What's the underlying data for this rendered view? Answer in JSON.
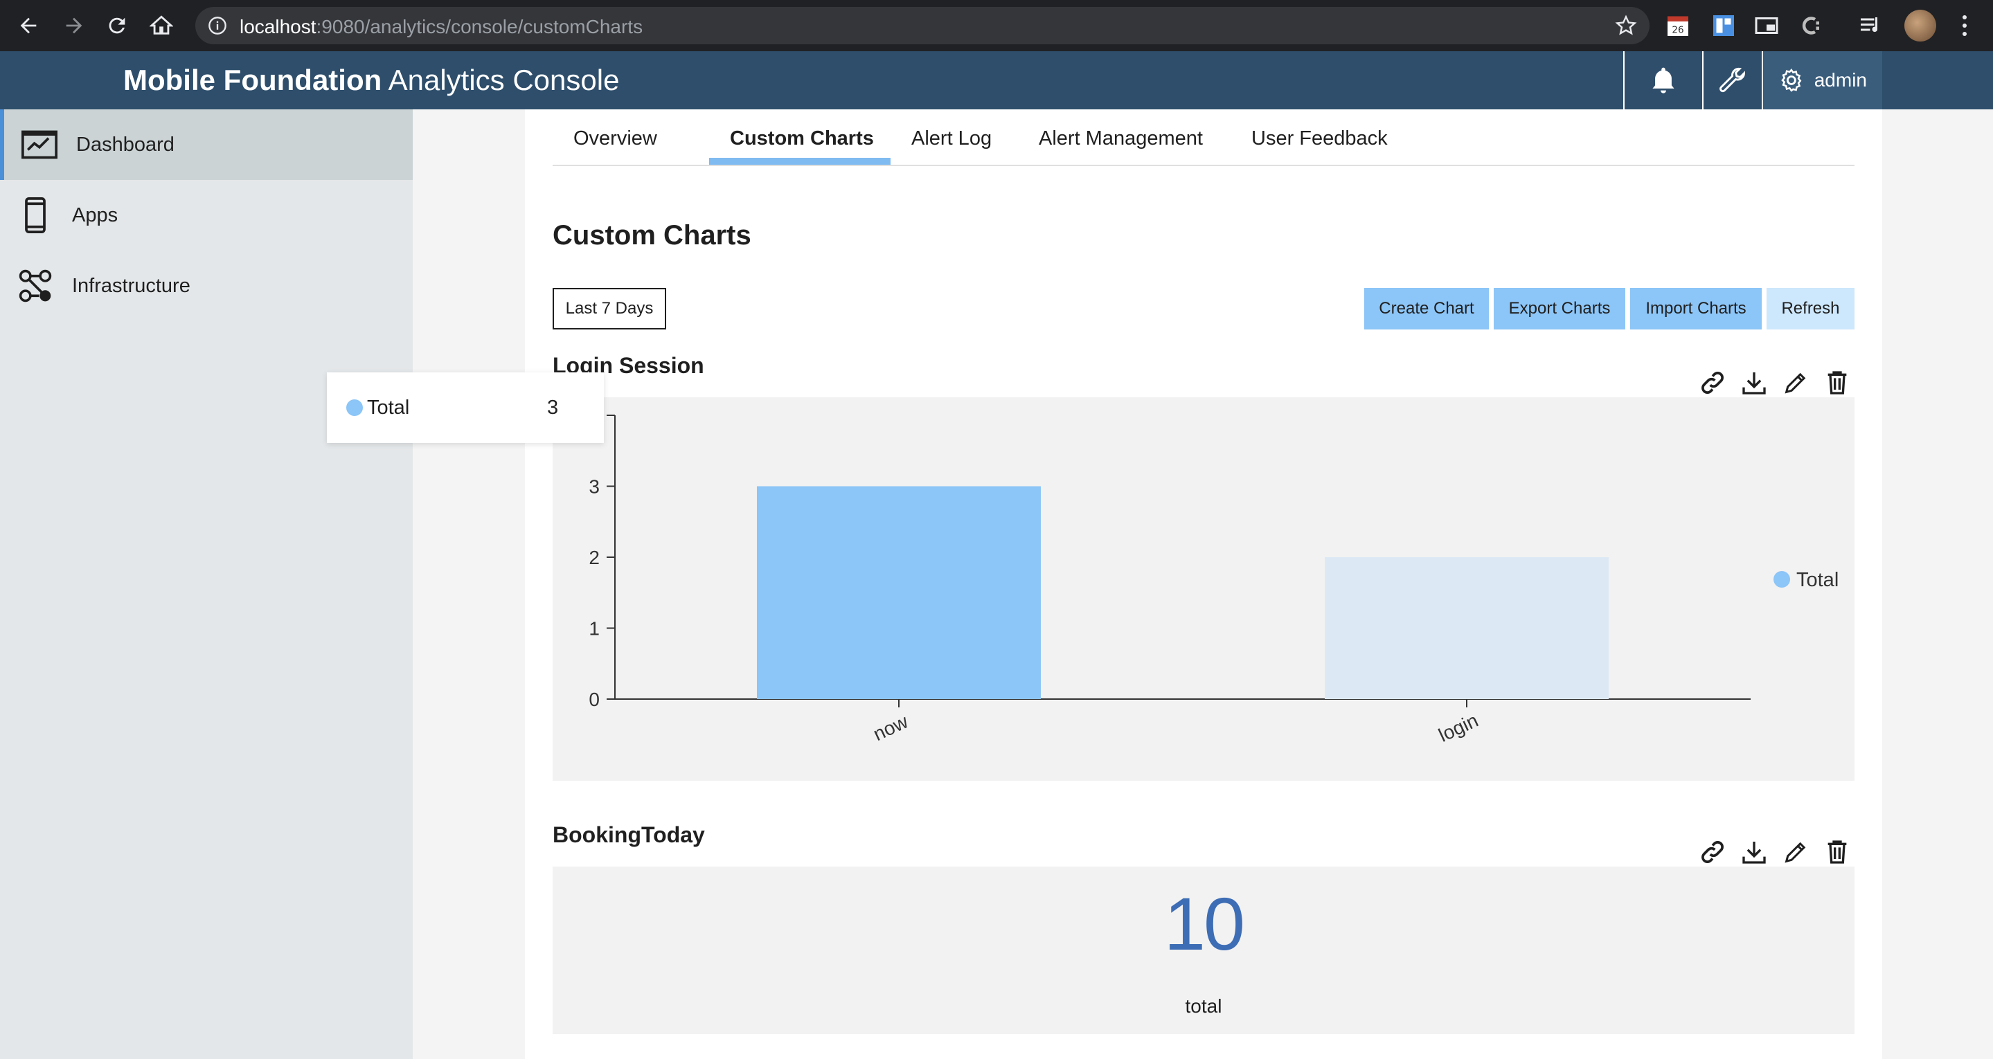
{
  "browser": {
    "url_host": "localhost",
    "url_path": ":9080/analytics/console/customCharts",
    "calendar_ext_day": "26"
  },
  "header": {
    "title_bold": "Mobile Foundation",
    "title_rest": " Analytics Console",
    "user": "admin"
  },
  "sidebar": {
    "items": [
      {
        "label": "Dashboard",
        "icon": "dashboard-icon",
        "active": true
      },
      {
        "label": "Apps",
        "icon": "mobile-phone-icon",
        "active": false
      },
      {
        "label": "Infrastructure",
        "icon": "network-nodes-icon",
        "active": false
      }
    ]
  },
  "tabs": [
    {
      "label": "Overview",
      "active": false
    },
    {
      "label": "Custom Charts",
      "active": true
    },
    {
      "label": "Alert Log",
      "active": false
    },
    {
      "label": "Alert Management",
      "active": false
    },
    {
      "label": "User Feedback",
      "active": false
    }
  ],
  "page": {
    "title": "Custom Charts",
    "range_button": "Last 7 Days",
    "actions": {
      "create": "Create Chart",
      "export": "Export Charts",
      "import": "Import Charts",
      "refresh": "Refresh"
    }
  },
  "tooltip": {
    "series": "Total",
    "value": "3"
  },
  "charts": {
    "login_session": {
      "title": "Login Session"
    },
    "booking_today": {
      "title": "BookingToday",
      "value": "10",
      "label": "total"
    }
  },
  "chart_data": {
    "type": "bar",
    "categories": [
      "now",
      "login"
    ],
    "series": [
      {
        "name": "Total",
        "values": [
          3,
          2
        ]
      }
    ],
    "bar_colors": [
      "#8cc5f7",
      "#dce9f5"
    ],
    "legend_color": "#8cc5f7",
    "ylim": [
      0,
      4
    ],
    "yticks": [
      0,
      1,
      2,
      3
    ],
    "legend_position": "right",
    "grid": false
  },
  "colors": {
    "header_bg": "#2e4e6b",
    "accent": "#8cc5f7",
    "metric": "#3d6db5"
  }
}
